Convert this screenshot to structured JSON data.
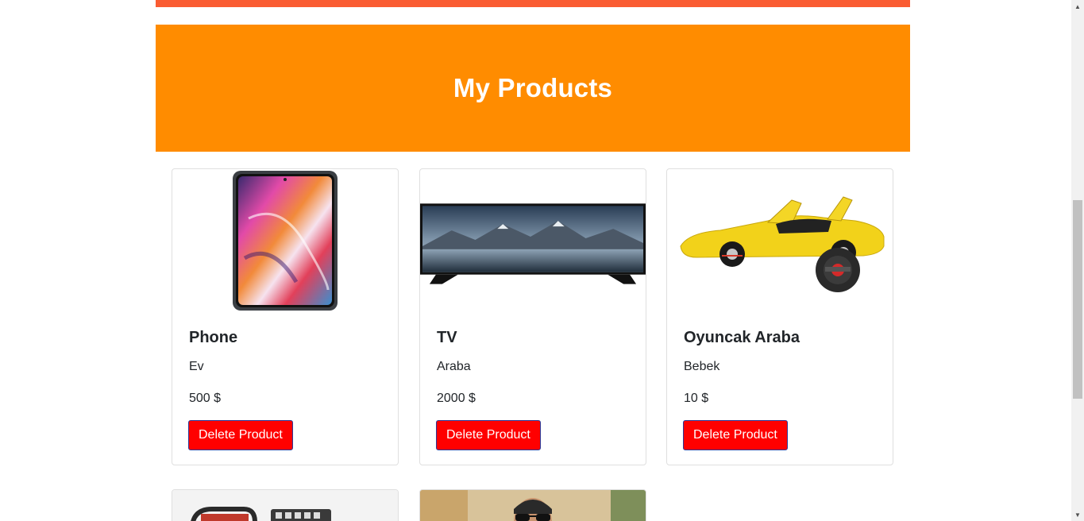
{
  "header": {
    "title": "My Products"
  },
  "products": [
    {
      "name": "Phone",
      "category": "Ev",
      "price": "500 $",
      "delete_label": "Delete Product",
      "image": "smartphone-image"
    },
    {
      "name": "TV",
      "category": "Araba",
      "price": "2000 $",
      "delete_label": "Delete Product",
      "image": "television-image"
    },
    {
      "name": "Oyuncak Araba",
      "category": "Bebek",
      "price": "10 $",
      "delete_label": "Delete Product",
      "image": "toy-car-image"
    },
    {
      "image": "equipment-image"
    },
    {
      "image": "person-image"
    }
  ],
  "colors": {
    "top_bar": "#fa5c32",
    "hero": "#ff8c00",
    "delete_button": "#ff0000"
  },
  "scrollbar": {
    "up_icon": "triangle-up-icon",
    "down_icon": "triangle-down-icon"
  }
}
